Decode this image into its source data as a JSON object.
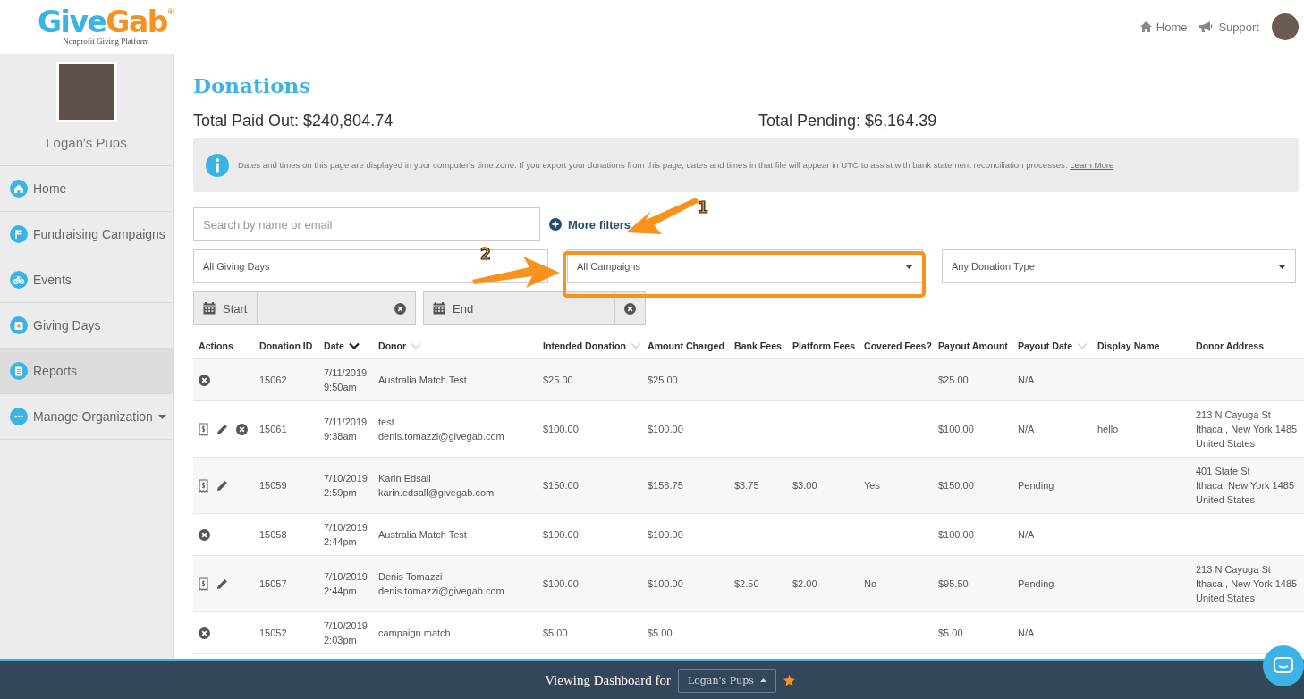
{
  "header": {
    "logo": {
      "first": "Give",
      "second": "Gab",
      "mark": "®",
      "tagline": "Nonprofit Giving Platform"
    },
    "links": [
      {
        "kind": "home",
        "label": "Home"
      },
      {
        "kind": "support",
        "label": "Support"
      }
    ]
  },
  "sidebar": {
    "org_name": "Logan's Pups",
    "items": [
      {
        "kind": "home",
        "label": "Home",
        "selected": false
      },
      {
        "kind": "campaigns",
        "label": "Fundraising Campaigns",
        "selected": false
      },
      {
        "kind": "events",
        "label": "Events",
        "selected": false
      },
      {
        "kind": "giving_days",
        "label": "Giving Days",
        "selected": false
      },
      {
        "kind": "reports",
        "label": "Reports",
        "selected": true
      },
      {
        "kind": "manage",
        "label": "Manage Organization",
        "selected": false,
        "has_menu": true
      }
    ]
  },
  "page": {
    "title": "Donations",
    "total_paid_out": "Total Paid Out: $240,804.74",
    "total_pending": "Total Pending: $6,164.39",
    "notice": {
      "text": "Dates and times on this page are displayed in your computer's time zone. If you export your donations from this page, dates and times in that file will appear in UTC to assist with bank statement reconciliation processes.",
      "link": "Learn More"
    }
  },
  "filters": {
    "search": {
      "placeholder": "Search by name or email"
    },
    "more_filters": "More filters",
    "selects": [
      {
        "value": "All Giving Days"
      },
      {
        "value": "All Campaigns"
      },
      {
        "value": "Any Donation Type"
      }
    ],
    "dates": [
      {
        "label": "Start"
      },
      {
        "label": "End"
      }
    ]
  },
  "annotations": [
    {
      "label": "1"
    },
    {
      "label": "2"
    }
  ],
  "table": {
    "columns": [
      {
        "label": "Actions"
      },
      {
        "label": "Donation ID"
      },
      {
        "label": "Date",
        "sorted": true
      },
      {
        "label": "Donor",
        "sorted": false
      },
      {
        "label": "Intended Donation",
        "sorted": false
      },
      {
        "label": "Amount Charged"
      },
      {
        "label": "Bank Fees"
      },
      {
        "label": "Platform Fees"
      },
      {
        "label": "Covered Fees?"
      },
      {
        "label": "Payout Amount"
      },
      {
        "label": "Payout Date",
        "sorted": false
      },
      {
        "label": "Display Name"
      },
      {
        "label": "Donor Address"
      }
    ],
    "rows": [
      {
        "actions": [
          {
            "kind": "cancel"
          }
        ],
        "id": "15062",
        "date": "7/11/2019",
        "time": "9:50am",
        "donor_name": "Australia Match Test",
        "intended": "$25.00",
        "charged": "$25.00",
        "payout_amount": "$25.00",
        "payout_date": "N/A"
      },
      {
        "actions": [
          {
            "kind": "receipt"
          },
          {
            "kind": "edit"
          },
          {
            "kind": "cancel"
          }
        ],
        "id": "15061",
        "date": "7/11/2019",
        "time": "9:38am",
        "donor_name": "test",
        "donor_email": "denis.tomazzi@givegab.com",
        "intended": "$100.00",
        "charged": "$100.00",
        "payout_amount": "$100.00",
        "payout_date": "N/A",
        "display_name": "hello",
        "address": [
          "213 N Cayuga St",
          "Ithaca , New York 1485",
          "United States"
        ]
      },
      {
        "actions": [
          {
            "kind": "receipt"
          },
          {
            "kind": "edit"
          }
        ],
        "id": "15059",
        "date": "7/10/2019",
        "time": "2:59pm",
        "donor_name": "Karin Edsall",
        "donor_email": "karin.edsall@givegab.com",
        "intended": "$150.00",
        "charged": "$156.75",
        "bank_fees": "$3.75",
        "platform_fees": "$3.00",
        "covered": "Yes",
        "payout_amount": "$150.00",
        "payout_date": "Pending",
        "address": [
          "401 State St",
          "Ithaca, New York 1485",
          "United States"
        ]
      },
      {
        "actions": [
          {
            "kind": "cancel"
          }
        ],
        "id": "15058",
        "date": "7/10/2019",
        "time": "2:44pm",
        "donor_name": "Australia Match Test",
        "intended": "$100.00",
        "charged": "$100.00",
        "payout_amount": "$100.00",
        "payout_date": "N/A"
      },
      {
        "actions": [
          {
            "kind": "receipt"
          },
          {
            "kind": "edit"
          }
        ],
        "id": "15057",
        "date": "7/10/2019",
        "time": "2:44pm",
        "donor_name": "Denis Tomazzi",
        "donor_email": "denis.tomazzi@givegab.com",
        "intended": "$100.00",
        "charged": "$100.00",
        "bank_fees": "$2.50",
        "platform_fees": "$2.00",
        "covered": "No",
        "payout_amount": "$95.50",
        "payout_date": "Pending",
        "address": [
          "213 N Cayuga St",
          "Ithaca , New York 1485",
          "United States"
        ]
      },
      {
        "actions": [
          {
            "kind": "cancel"
          }
        ],
        "id": "15052",
        "date": "7/10/2019",
        "time": "2:03pm",
        "donor_name": "campaign match",
        "intended": "$5.00",
        "charged": "$5.00",
        "payout_amount": "$5.00",
        "payout_date": "N/A"
      }
    ]
  },
  "footer": {
    "text": "Viewing Dashboard for",
    "org_button": "Logan's Pups",
    "favorite": true
  }
}
